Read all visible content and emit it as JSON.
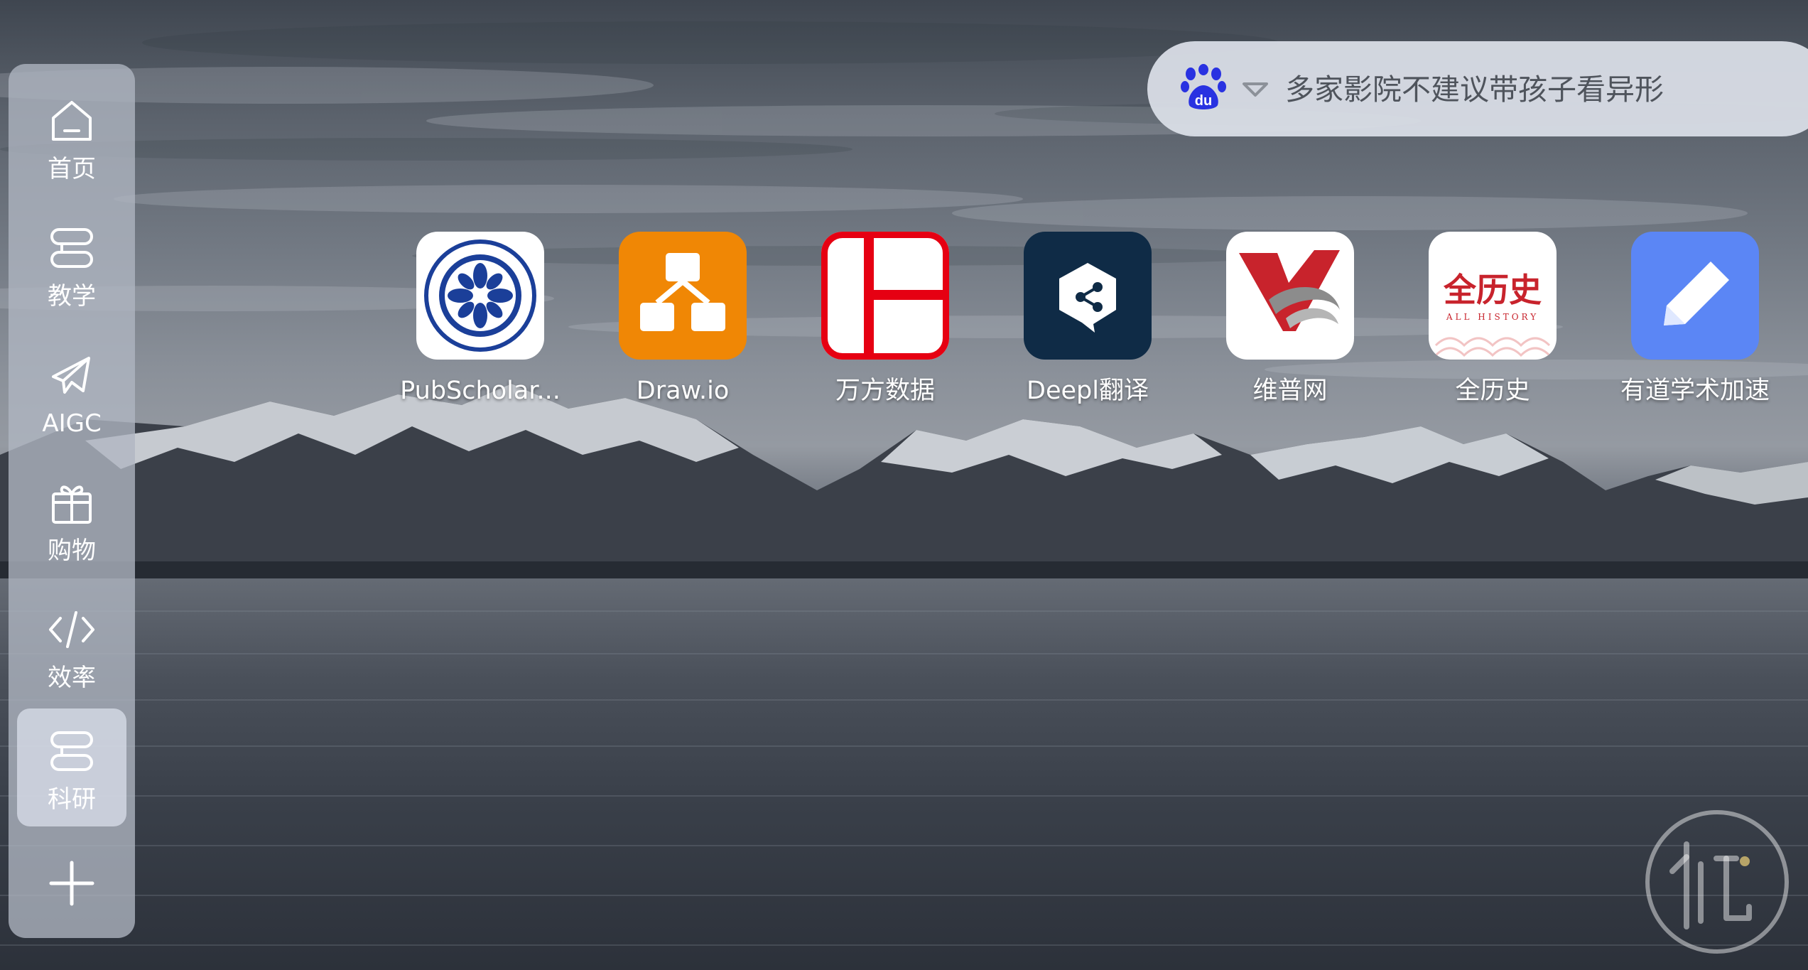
{
  "sidebar": {
    "items": [
      {
        "label": "首页",
        "icon": "home-icon"
      },
      {
        "label": "教学",
        "icon": "stack-icon"
      },
      {
        "label": "AIGC",
        "icon": "airplane-icon"
      },
      {
        "label": "购物",
        "icon": "gift-icon"
      },
      {
        "label": "效率",
        "icon": "code-icon"
      },
      {
        "label": "科研",
        "icon": "stack-icon",
        "active": true
      }
    ],
    "add_icon": "plus-icon"
  },
  "search": {
    "engine_icon": "baidu-paw-icon",
    "placeholder": "多家影院不建议带孩子看异形"
  },
  "shortcuts": [
    {
      "label": "PubScholar...",
      "icon": "pubscholar-logo-icon",
      "color": "#ffffff"
    },
    {
      "label": "Draw.io",
      "icon": "drawio-logo-icon",
      "color": "#f08705"
    },
    {
      "label": "万方数据",
      "icon": "wanfang-logo-icon",
      "color": "#e60012"
    },
    {
      "label": "Deepl翻译",
      "icon": "deepl-logo-icon",
      "color": "#0f2b46"
    },
    {
      "label": "维普网",
      "icon": "vip-logo-icon",
      "color": "#ffffff"
    },
    {
      "label": "全历史",
      "icon": "allhistory-logo-icon",
      "color": "#ffffff",
      "logo_text": "全历史",
      "logo_subtext": "ALL HISTORY"
    },
    {
      "label": "有道学术加速",
      "icon": "youdao-pen-logo-icon",
      "color": "#5b86f5"
    }
  ],
  "colors": {
    "sidebar_bg": "#b1b7c2",
    "baidu_blue": "#2932e1",
    "logo_red": "#c8232c"
  }
}
